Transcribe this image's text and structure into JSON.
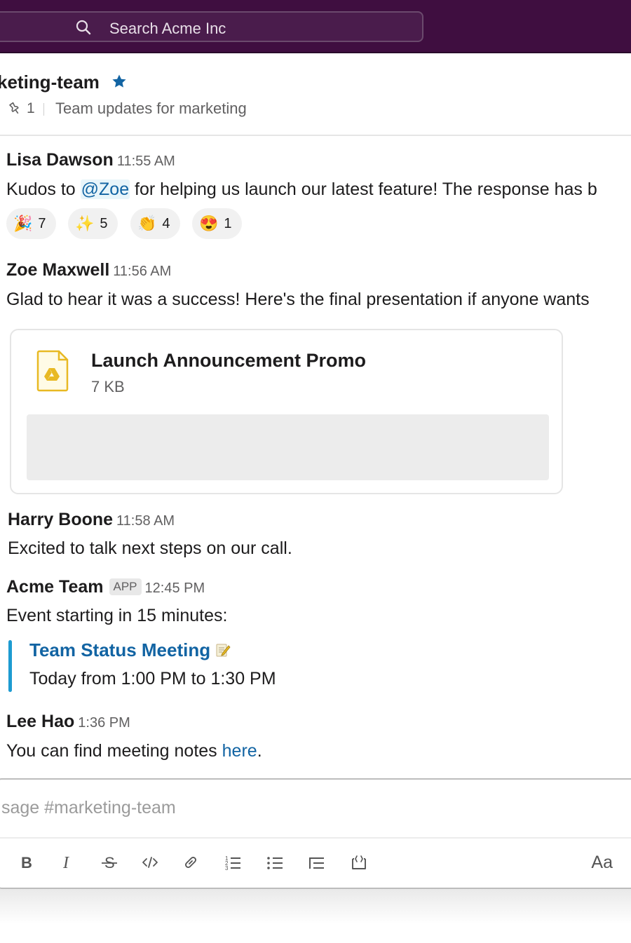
{
  "search": {
    "placeholder": "Search Acme Inc"
  },
  "channel": {
    "name": "keting-team",
    "pin_count": "1",
    "topic": "Team updates for marketing"
  },
  "messages": [
    {
      "sender": "Lisa Dawson",
      "time": "11:55 AM",
      "text_before": "Kudos to ",
      "mention": "@Zoe",
      "text_after": " for helping us launch our latest feature! The response has b",
      "reactions": [
        {
          "emoji": "🎉",
          "count": "7"
        },
        {
          "emoji": "✨",
          "count": "5"
        },
        {
          "emoji": "👏",
          "count": "4"
        },
        {
          "emoji": "😍",
          "count": "1"
        }
      ]
    },
    {
      "sender": "Zoe Maxwell",
      "time": "11:56 AM",
      "text": "Glad to hear it was a success! Here's the final presentation if anyone wants",
      "attachment": {
        "title": "Launch Announcement Promo",
        "size": "7 KB"
      }
    },
    {
      "sender": "Harry Boone",
      "time": "11:58 AM",
      "text": "Excited to talk next steps on our call."
    },
    {
      "sender": "Acme Team",
      "badge": "APP",
      "time": "12:45 PM",
      "text": "Event starting in 15 minutes:",
      "event": {
        "title": "Team Status Meeting",
        "time": "Today from 1:00 PM to 1:30 PM"
      }
    },
    {
      "sender": "Lee Hao",
      "time": "1:36 PM",
      "text_before": "You can find meeting notes ",
      "link": "here",
      "text_after": "."
    }
  ],
  "composer": {
    "placeholder": "sage #marketing-team",
    "format_label": "Aa",
    "toolbar": [
      "bold-icon",
      "italic-icon",
      "strikethrough-icon",
      "code-icon",
      "link-icon",
      "ordered-list-icon",
      "bulleted-list-icon",
      "blockquote-icon",
      "code-block-icon"
    ]
  },
  "colors": {
    "topbar": "#3f0e40",
    "link": "#1264a3",
    "quote_bar": "#1d9bd1"
  }
}
